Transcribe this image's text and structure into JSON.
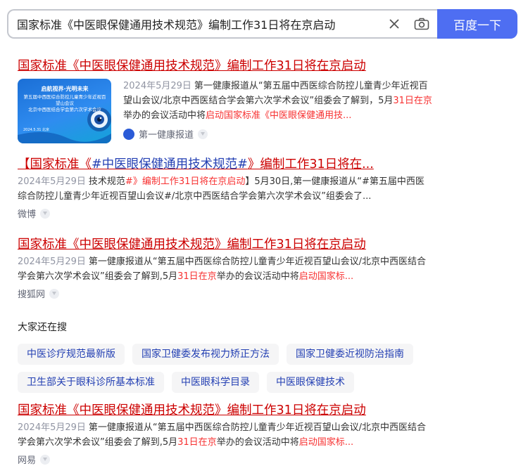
{
  "search": {
    "query": "国家标准《中医眼保健通用技术规范》编制工作31日将在京启动",
    "button_label": "百度一下"
  },
  "results": [
    {
      "title": "国家标准《中医眼保健通用技术规范》编制工作31日将在京启动",
      "date": "2024年5月29日",
      "snippet_a": "第一健康报道从“第五届中西医综合防控儿童青少年近视百望山会议/北京中西医结合学会第六次学术会议”组委会了解到，5月",
      "snippet_hl1": "31日在京",
      "snippet_b": "举办的会议活动中将",
      "snippet_hl2": "启动国家标准《中医眼保健通用技...",
      "source": "第一健康报道",
      "thumb_caption_1": "启航视界·光明未来",
      "thumb_caption_2": "第五届中西医综合防控儿童青少年近视百望山会议",
      "thumb_caption_3": "北京中西医结合学会第六次学术会议",
      "thumb_date": "2024.5.31 北京"
    },
    {
      "title_a": "【国家标准《",
      "title_b": "#中医眼保健通用技术规范#",
      "title_c": "》编制工作31日将在...",
      "date": "2024年5月29日",
      "snippet_a": "技术规范",
      "snippet_hl1": "#》编制工作31日将在京启动",
      "snippet_b": "】5月30日,第一健康报道从“#第五届中西医综合防控儿童青少年近视百望山会议#/北京中西医结合学会第六次学术会议”组委会了...",
      "source": "微博"
    },
    {
      "title": "国家标准《中医眼保健通用技术规范》编制工作31日将在京启动",
      "date": "2024年5月29日",
      "snippet_a": "第一健康报道从“第五届中西医综合防控儿童青少年近视百望山会议/北京中西医结合学会第六次学术会议”组委会了解到,5月",
      "snippet_hl1": "31日在京",
      "snippet_b": "举办的会议活动中将",
      "snippet_hl2": "启动国家标...",
      "source": "搜狐网"
    },
    {
      "title": "国家标准《中医眼保健通用技术规范》编制工作31日将在京启动",
      "date": "2024年5月29日",
      "snippet_a": "第一健康报道从“第五届中西医综合防控儿童青少年近视百望山会议/北京中西医结合学会第六次学术会议”组委会了解到,5月",
      "snippet_hl1": "31日在京",
      "snippet_b": "举办的会议活动中将",
      "snippet_hl2": "启动国家标...",
      "source": "网易"
    }
  ],
  "related": {
    "heading": "大家还在搜",
    "items": [
      "中医诊疗规范最新版",
      "国家卫健委发布视力矫正方法",
      "国家卫健委近视防治指南",
      "卫生部关于眼科诊所基本标准",
      "中医眼科学目录",
      "中医眼保健技术"
    ]
  },
  "colors": {
    "title_red": "#cc0000",
    "highlight": "#f73131",
    "link_blue": "#2440b3",
    "button": "#4e6ef2"
  }
}
